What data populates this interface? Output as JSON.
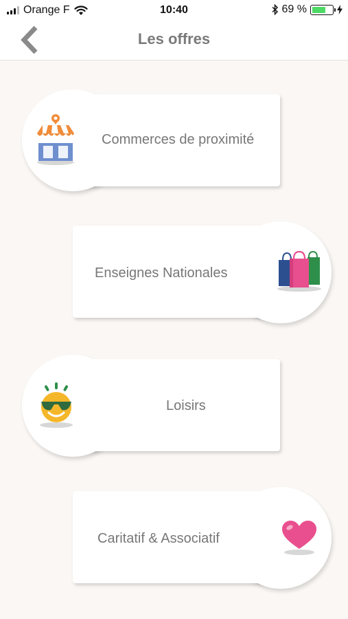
{
  "status_bar": {
    "carrier": "Orange F",
    "time": "10:40",
    "battery_percent": "69 %",
    "battery_level": 0.69
  },
  "nav": {
    "title": "Les offres",
    "back_icon": "chevron-left-icon"
  },
  "offers": [
    {
      "label": "Commerces de proximité",
      "icon": "storefront-icon"
    },
    {
      "label": "Enseignes Nationales",
      "icon": "shopping-bags-icon"
    },
    {
      "label": "Loisirs",
      "icon": "sunglasses-smiley-icon"
    },
    {
      "label": "Caritatif & Associatif",
      "icon": "heart-icon"
    }
  ],
  "colors": {
    "background": "#faf7f4",
    "text": "#777777",
    "title": "#7a7a7a",
    "battery": "#4cd964"
  }
}
